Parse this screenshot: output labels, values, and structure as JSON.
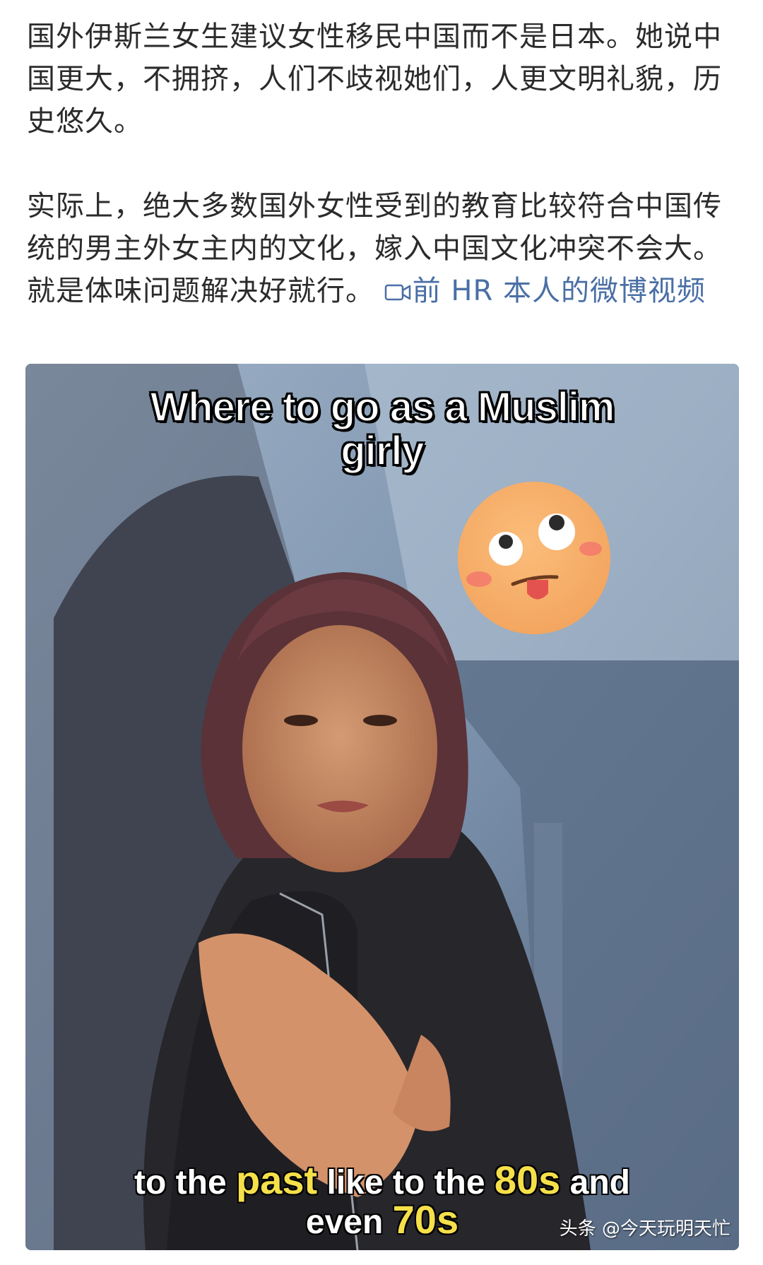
{
  "post": {
    "paragraph1": "国外伊斯兰女生建议女性移民中国而不是日本。她说中国更大，不拥挤，人们不歧视她们，人更文明礼貌，历史悠久。",
    "paragraph2": "实际上，绝大多数国外女性受到的教育比较符合中国传统的男主外女主内的文化，嫁入中国文化冲突不会大。就是体味问题解决好就行。",
    "video_link_label": "前 HR 本人的微博视频",
    "video_link_icon": "video-camera-icon",
    "link_color": "#4a6fa5"
  },
  "video": {
    "caption_top_line1": "Where to go as a Muslim",
    "caption_top_line2": "girly",
    "caption_bottom": {
      "part1": "to the ",
      "highlight1": "past",
      "part2": " like to the ",
      "highlight2": "80s",
      "part3": " and",
      "line2_prefix": "even ",
      "highlight3": "70s"
    },
    "highlight_color": "#f6e04a",
    "emoji_sticker": "silly-face-emoji",
    "watermark": "头条 @今天玩明天忙"
  }
}
